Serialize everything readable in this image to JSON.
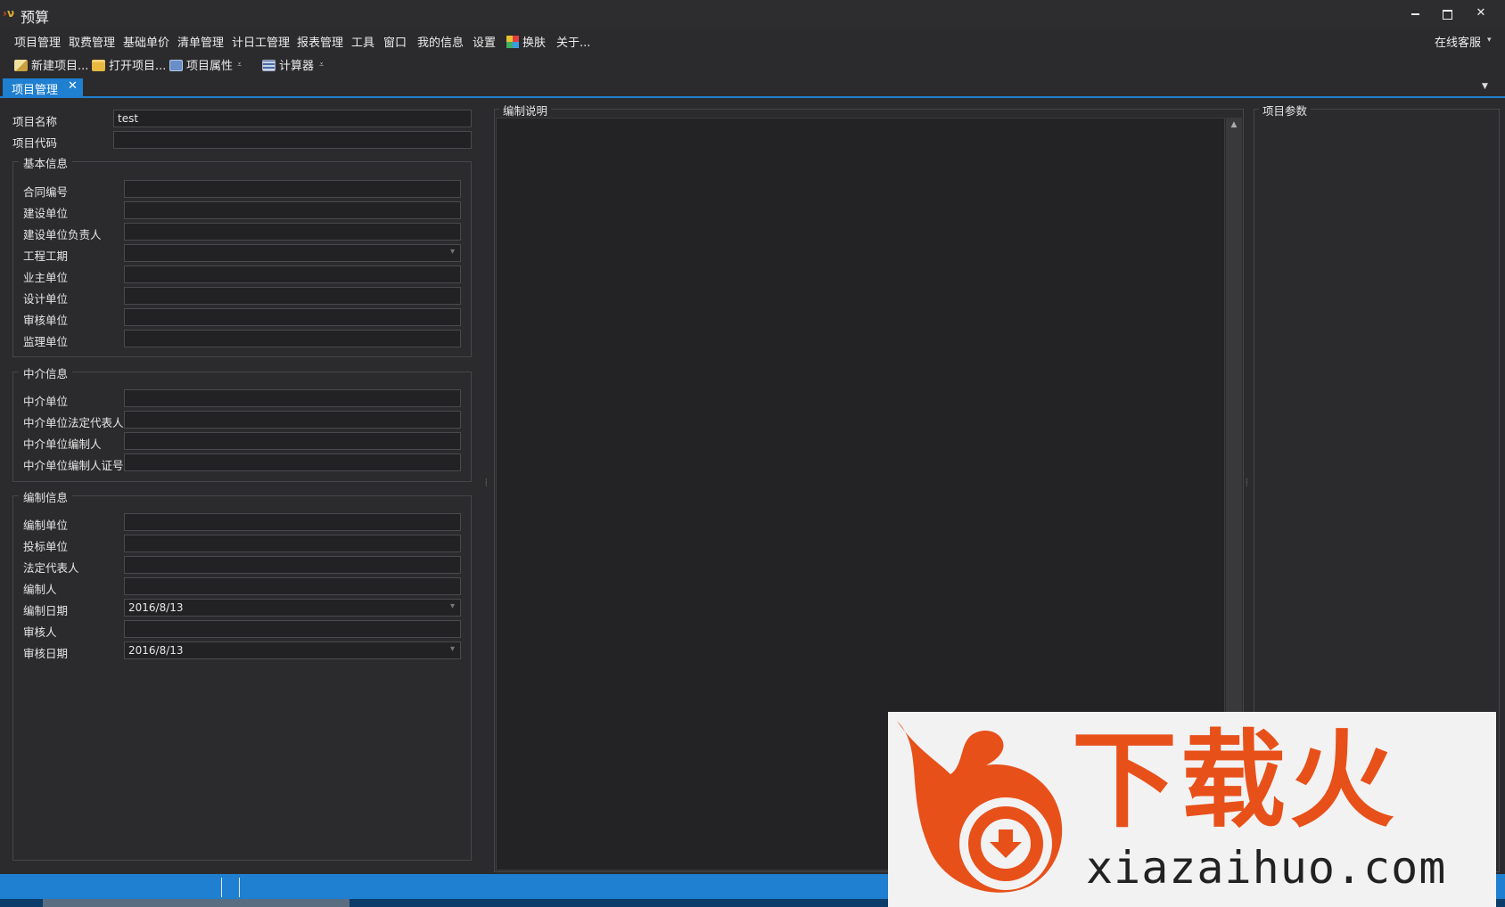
{
  "window": {
    "title": "预算",
    "logo_text": "ν"
  },
  "menu": {
    "items": [
      "项目管理",
      "取费管理",
      "基础单价",
      "清单管理",
      "计日工管理",
      "报表管理",
      "工具",
      "窗口",
      "我的信息",
      "设置",
      "换肤",
      "关于..."
    ],
    "online_service": "在线客服"
  },
  "toolbar": {
    "new_project": "新建项目...",
    "open_project": "打开项目...",
    "project_props": "项目属性",
    "calculator": "计算器"
  },
  "tabs": {
    "active": "项目管理"
  },
  "form": {
    "project_name_label": "项目名称",
    "project_name_value": "test",
    "project_code_label": "项目代码",
    "project_code_value": "",
    "basic": {
      "title": "基本信息",
      "fields": [
        {
          "label": "合同编号",
          "value": ""
        },
        {
          "label": "建设单位",
          "value": ""
        },
        {
          "label": "建设单位负责人",
          "value": ""
        },
        {
          "label": "工程工期",
          "value": ""
        },
        {
          "label": "业主单位",
          "value": ""
        },
        {
          "label": "设计单位",
          "value": ""
        },
        {
          "label": "审核单位",
          "value": ""
        },
        {
          "label": "监理单位",
          "value": ""
        }
      ]
    },
    "agency": {
      "title": "中介信息",
      "fields": [
        {
          "label": "中介单位",
          "value": ""
        },
        {
          "label": "中介单位法定代表人",
          "value": ""
        },
        {
          "label": "中介单位编制人",
          "value": ""
        },
        {
          "label": "中介单位编制人证号",
          "value": ""
        }
      ]
    },
    "compile": {
      "title": "编制信息",
      "fields": [
        {
          "label": "编制单位",
          "value": ""
        },
        {
          "label": "投标单位",
          "value": ""
        },
        {
          "label": "法定代表人",
          "value": ""
        },
        {
          "label": "编制人",
          "value": ""
        },
        {
          "label": "编制日期",
          "value": "2016/8/13"
        },
        {
          "label": "审核人",
          "value": ""
        },
        {
          "label": "审核日期",
          "value": "2016/8/13"
        }
      ]
    }
  },
  "panels": {
    "description_title": "编制说明",
    "params_title": "项目参数"
  },
  "watermark": {
    "brand": "下载火",
    "domain": "xiazaihuo.com"
  },
  "colors": {
    "accent": "#1f7fd0",
    "background": "#2b2b2d",
    "watermark_orange": "#e8501a"
  }
}
